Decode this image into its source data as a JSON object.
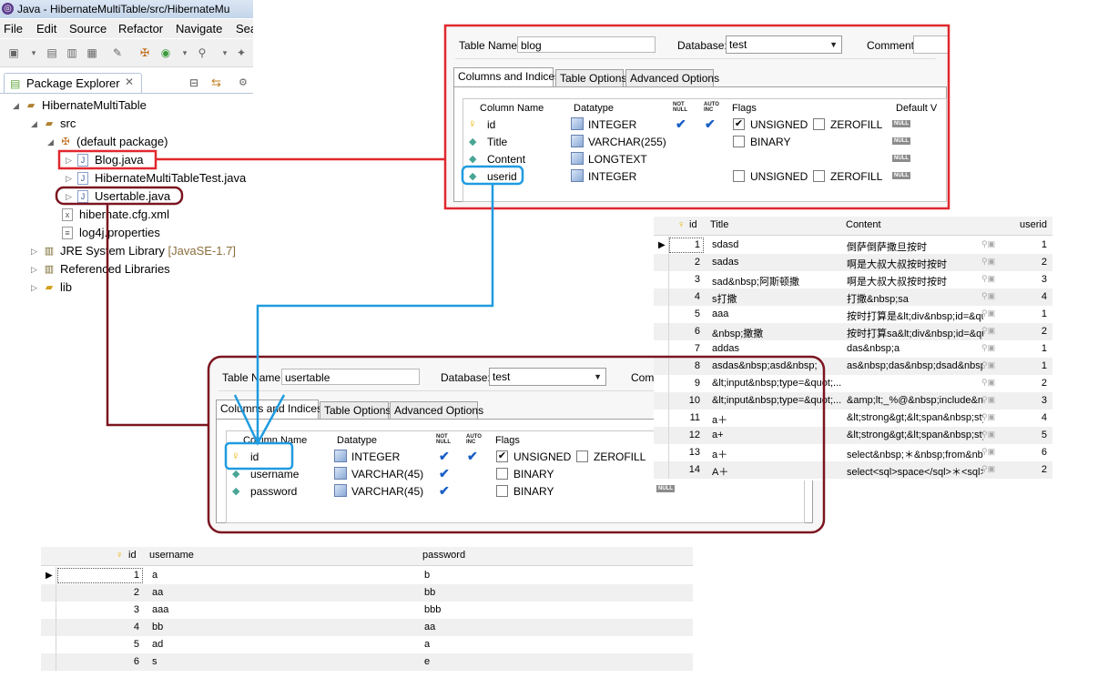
{
  "eclipse": {
    "title": "Java - HibernateMultiTable/src/HibernateMu",
    "menu": [
      "File",
      "Edit",
      "Source",
      "Refactor",
      "Navigate",
      "Sea"
    ],
    "view_tab": "Package Explorer",
    "tree": [
      {
        "label": "HibernateMultiTable",
        "icon": "project-icon"
      },
      {
        "label": "src",
        "icon": "source-folder-icon"
      },
      {
        "label": "(default package)",
        "icon": "package-icon"
      },
      {
        "label": "Blog.java",
        "icon": "java-file-icon"
      },
      {
        "label": "HibernateMultiTableTest.java",
        "icon": "java-file-icon"
      },
      {
        "label": "Usertable.java",
        "icon": "java-file-icon"
      },
      {
        "label": "hibernate.cfg.xml",
        "icon": "xml-file-icon"
      },
      {
        "label": "log4j.properties",
        "icon": "properties-file-icon"
      },
      {
        "label": "JRE System Library",
        "decoration": "[JavaSE-1.7]",
        "icon": "library-icon"
      },
      {
        "label": "Referenced Libraries",
        "icon": "library-icon"
      },
      {
        "label": "lib",
        "icon": "folder-icon"
      }
    ]
  },
  "blog_designer": {
    "table_name_label": "Table Name:",
    "table_name": "blog",
    "database_label": "Database:",
    "database": "test",
    "comment_label": "Comment:",
    "tabs": [
      "Columns and Indices",
      "Table Options",
      "Advanced Options"
    ],
    "headers": {
      "name": "Column Name",
      "datatype": "Datatype",
      "notnull": "NOT NULL",
      "autoinc": "AUTO INC",
      "flags": "Flags",
      "default": "Default V"
    },
    "columns": [
      {
        "name": "id",
        "type": "INTEGER",
        "pk": true,
        "notnull": true,
        "autoinc": true,
        "flag1": "UNSIGNED",
        "flag1_checked": true,
        "flag2": "ZEROFILL",
        "flag2_checked": false,
        "null_badge": "NULL"
      },
      {
        "name": "Title",
        "type": "VARCHAR(255)",
        "pk": false,
        "notnull": false,
        "autoinc": false,
        "flag1": "BINARY",
        "flag1_checked": false,
        "flag2": "",
        "null_badge": "NULL"
      },
      {
        "name": "Content",
        "type": "LONGTEXT",
        "pk": false,
        "notnull": false,
        "autoinc": false,
        "flag1": "",
        "flag2": "",
        "null_badge": "NULL"
      },
      {
        "name": "userid",
        "type": "INTEGER",
        "pk": false,
        "notnull": false,
        "autoinc": false,
        "flag1": "UNSIGNED",
        "flag1_checked": false,
        "flag2": "ZEROFILL",
        "flag2_checked": false,
        "null_badge": "NULL"
      }
    ]
  },
  "user_designer": {
    "table_name_label": "Table Name:",
    "table_name": "usertable",
    "database_label": "Database:",
    "database": "test",
    "comment_label": "Comm",
    "tabs": [
      "Columns and Indices",
      "Table Options",
      "Advanced Options"
    ],
    "headers": {
      "name": "Column Name",
      "datatype": "Datatype",
      "notnull": "NOT NULL",
      "autoinc": "AUTO INC",
      "flags": "Flags"
    },
    "columns": [
      {
        "name": "id",
        "type": "INTEGER",
        "pk": true,
        "notnull": true,
        "autoinc": true,
        "flag1": "UNSIGNED",
        "flag1_checked": true,
        "flag2": "ZEROFILL",
        "flag2_checked": false
      },
      {
        "name": "username",
        "type": "VARCHAR(45)",
        "pk": false,
        "notnull": true,
        "autoinc": false,
        "flag1": "BINARY",
        "flag1_checked": false,
        "flag2": ""
      },
      {
        "name": "password",
        "type": "VARCHAR(45)",
        "pk": false,
        "notnull": true,
        "autoinc": false,
        "flag1": "BINARY",
        "flag1_checked": false,
        "flag2": "",
        "null_badge": "NULL"
      }
    ]
  },
  "blog_data": {
    "headers": [
      "id",
      "Title",
      "Content",
      "userid"
    ],
    "rows": [
      [
        "1",
        "sdasd",
        "倒萨倒萨撒旦按时",
        "1"
      ],
      [
        "2",
        "sadas",
        "啊是大叔大叔按时按时",
        "2"
      ],
      [
        "3",
        "sad&nbsp;阿斯顿撒",
        "啊是大叔大叔按时按时",
        "3"
      ],
      [
        "4",
        "s打撒",
        "打撒&nbsp;sa",
        "4"
      ],
      [
        "5",
        "aaa",
        "按时打算是&lt;div&nbsp;id=&qu...",
        "1"
      ],
      [
        "6",
        "&nbsp;撒撒",
        "按时打算sa&lt;div&nbsp;id=&qu...",
        "2"
      ],
      [
        "7",
        "addas",
        "das&nbsp;a",
        "1"
      ],
      [
        "8",
        "asdas&nbsp;asd&nbsp;",
        "as&nbsp;das&nbsp;dsad&nbsp;a...",
        "1"
      ],
      [
        "9",
        "&lt;input&nbsp;type=&quot;...",
        "",
        "2"
      ],
      [
        "10",
        "&lt;input&nbsp;type=&quot;...",
        "&amp;lt;_%@&nbsp;include&nbs...",
        "3"
      ],
      [
        "11",
        "a＋",
        "&lt;strong&gt;&lt;span&nbsp;style...",
        "4"
      ],
      [
        "12",
        "a+",
        "&lt;strong&gt;&lt;span&nbsp;style...",
        "5"
      ],
      [
        "13",
        "a＋",
        "select&nbsp;＊&nbsp;from&nbsp...",
        "6"
      ],
      [
        "14",
        "A＋",
        "select<sql>space</sql>＊<sql>s...",
        "2"
      ]
    ]
  },
  "user_data": {
    "headers": [
      "id",
      "username",
      "password"
    ],
    "rows": [
      [
        "1",
        "a",
        "b"
      ],
      [
        "2",
        "aa",
        "bb"
      ],
      [
        "3",
        "aaa",
        "bbb"
      ],
      [
        "4",
        "bb",
        "aa"
      ],
      [
        "5",
        "ad",
        "a"
      ],
      [
        "6",
        "s",
        "e"
      ]
    ]
  },
  "colors": {
    "highlight_red": "#e0282e",
    "highlight_darkred": "#7b1520",
    "highlight_blue": "#1f9be0"
  }
}
